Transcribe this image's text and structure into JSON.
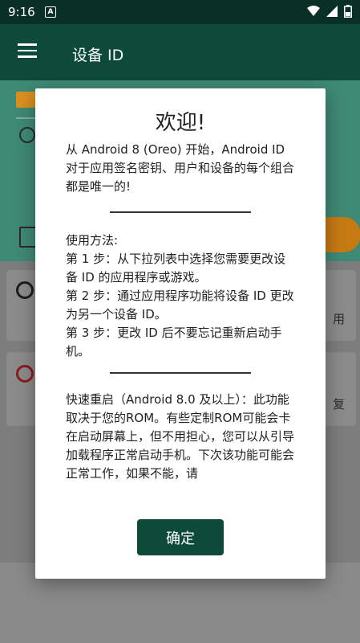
{
  "status_bar": {
    "time": "9:16",
    "notification_badge": "A",
    "icons": [
      "wifi-icon",
      "signal-icon",
      "battery-icon"
    ]
  },
  "app_bar": {
    "title": "设备 ID"
  },
  "background": {
    "card1_side_text": "用",
    "card2_side_text": "复"
  },
  "dialog": {
    "title": "欢迎!",
    "intro": "从 Android 8 (Oreo) 开始，Android ID 对于应用签名密钥、用户和设备的每个组合都是唯一的!",
    "usage_heading": "使用方法:",
    "steps": [
      "第 1 步：从下拉列表中选择您需要更改设备 ID 的应用程序或游戏。",
      "第 2 步：通过应用程序功能将设备 ID 更改为另一个设备 ID。",
      "第 3 步：更改 ID 后不要忘记重新启动手机。"
    ],
    "quick_reboot": "快速重启（Android 8.0 及以上）：此功能取决于您的ROM。有些定制ROM可能会卡在启动屏幕上，但不用担心，您可以从引导加载程序正常启动手机。下次该功能可能会正常工作，如果不能，请",
    "ok_button": "确定"
  },
  "colors": {
    "primary": "#0d4a3a",
    "status_bar": "#0a2f27",
    "accent": "#d9901f"
  }
}
